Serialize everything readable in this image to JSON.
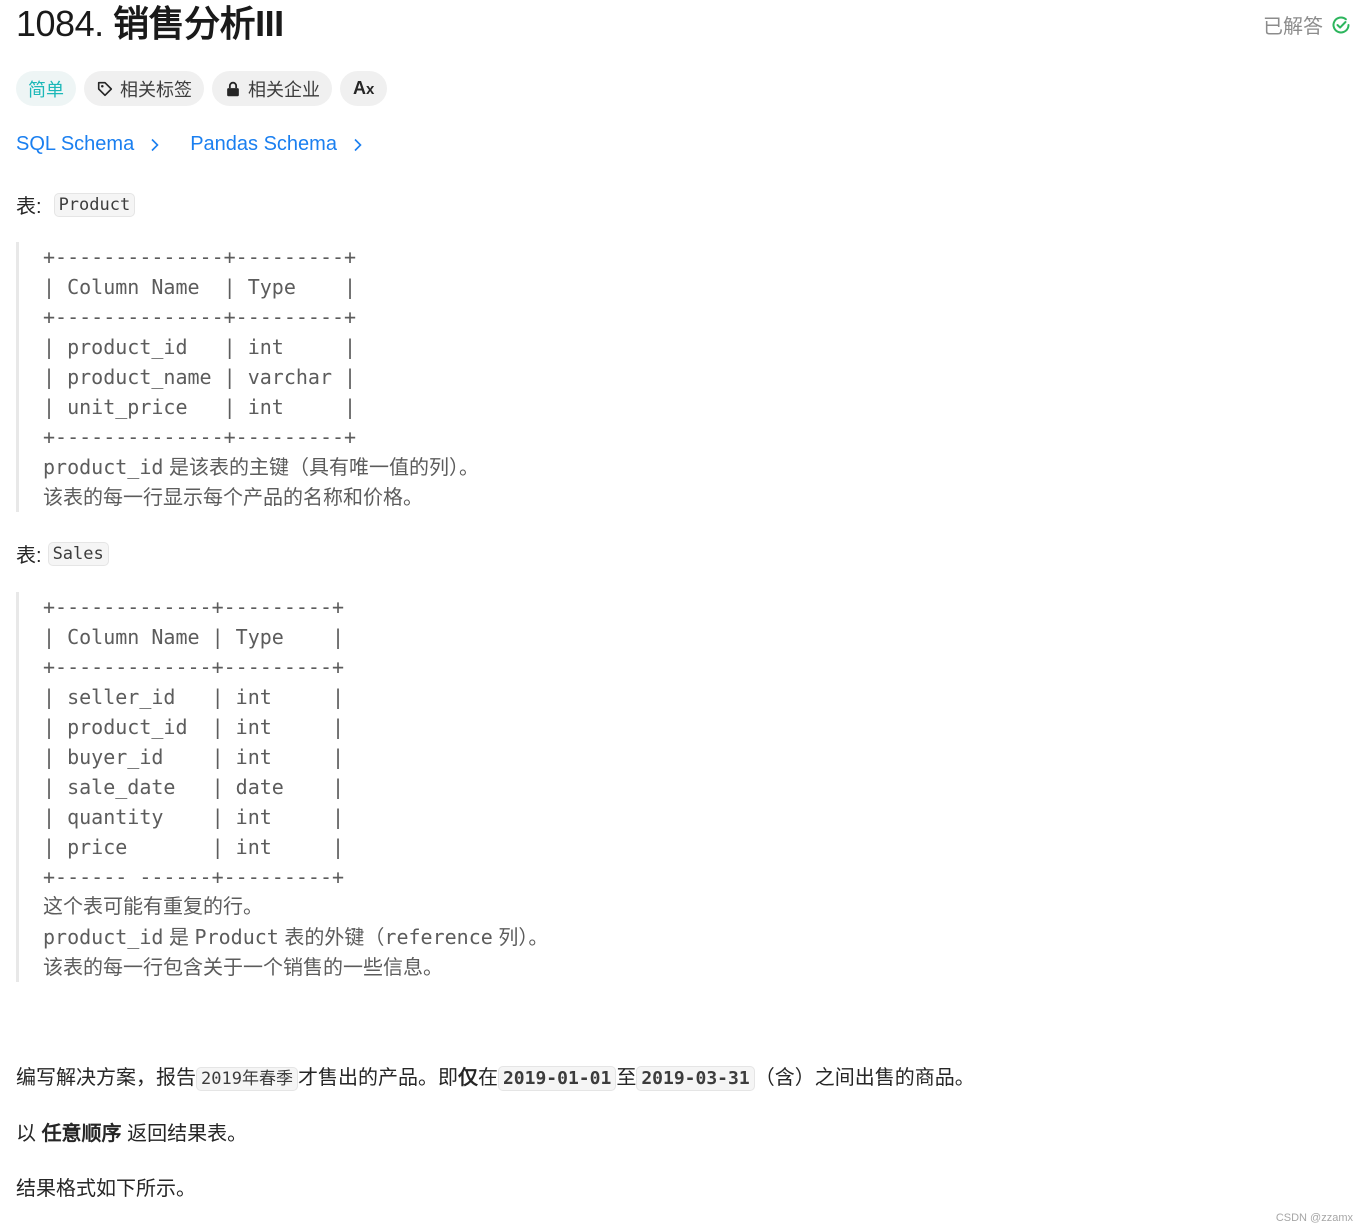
{
  "problem": {
    "number": "1084.",
    "title": "销售分析III",
    "status_label": "已解答",
    "status_color": "#2db55d"
  },
  "tags": {
    "difficulty": "简单",
    "related_topics": "相关标签",
    "related_companies": "相关企业",
    "language_toggle": "Aᴀ"
  },
  "schema_links": [
    {
      "label": "SQL Schema"
    },
    {
      "label": "Pandas Schema"
    }
  ],
  "product_table": {
    "label_prefix": "表:",
    "name": "Product",
    "lines": [
      "+--------------+---------+",
      "| Column Name  | Type    |",
      "+--------------+---------+",
      "| product_id   | int     |",
      "| product_name | varchar |",
      "| unit_price   | int     |",
      "+--------------+---------+"
    ],
    "notes": [
      {
        "mono": "product_id",
        "text": " 是该表的主键（具有唯一值的列）。"
      },
      {
        "mono": "",
        "text": "该表的每一行显示每个产品的名称和价格。"
      }
    ]
  },
  "sales_table": {
    "label_prefix": "表:",
    "name": "Sales",
    "lines": [
      "+-------------+---------+",
      "| Column Name | Type    |",
      "+-------------+---------+",
      "| seller_id   | int     |",
      "| product_id  | int     |",
      "| buyer_id    | int     |",
      "| sale_date   | date    |",
      "| quantity    | int     |",
      "| price       | int     |",
      "+------ ------+---------+"
    ],
    "notes": [
      "这个表可能有重复的行。",
      "product_id 是 Product 表的外键（reference 列）。",
      "该表的每一行包含关于一个销售的一些信息。"
    ]
  },
  "description": {
    "p1_a": "编写解决方案，报告",
    "p1_code1": "2019年春季",
    "p1_b": "才售出的产品。即",
    "p1_bold": "仅",
    "p1_c": "在",
    "p1_code2": "2019-01-01",
    "p1_d": "至",
    "p1_code3": "2019-03-31",
    "p1_e": "（含）之间出售的商品。",
    "p2_a": "以 ",
    "p2_bold": "任意顺序",
    "p2_b": " 返回结果表。",
    "p3": "结果格式如下所示。"
  },
  "watermark": "CSDN @zzamx"
}
